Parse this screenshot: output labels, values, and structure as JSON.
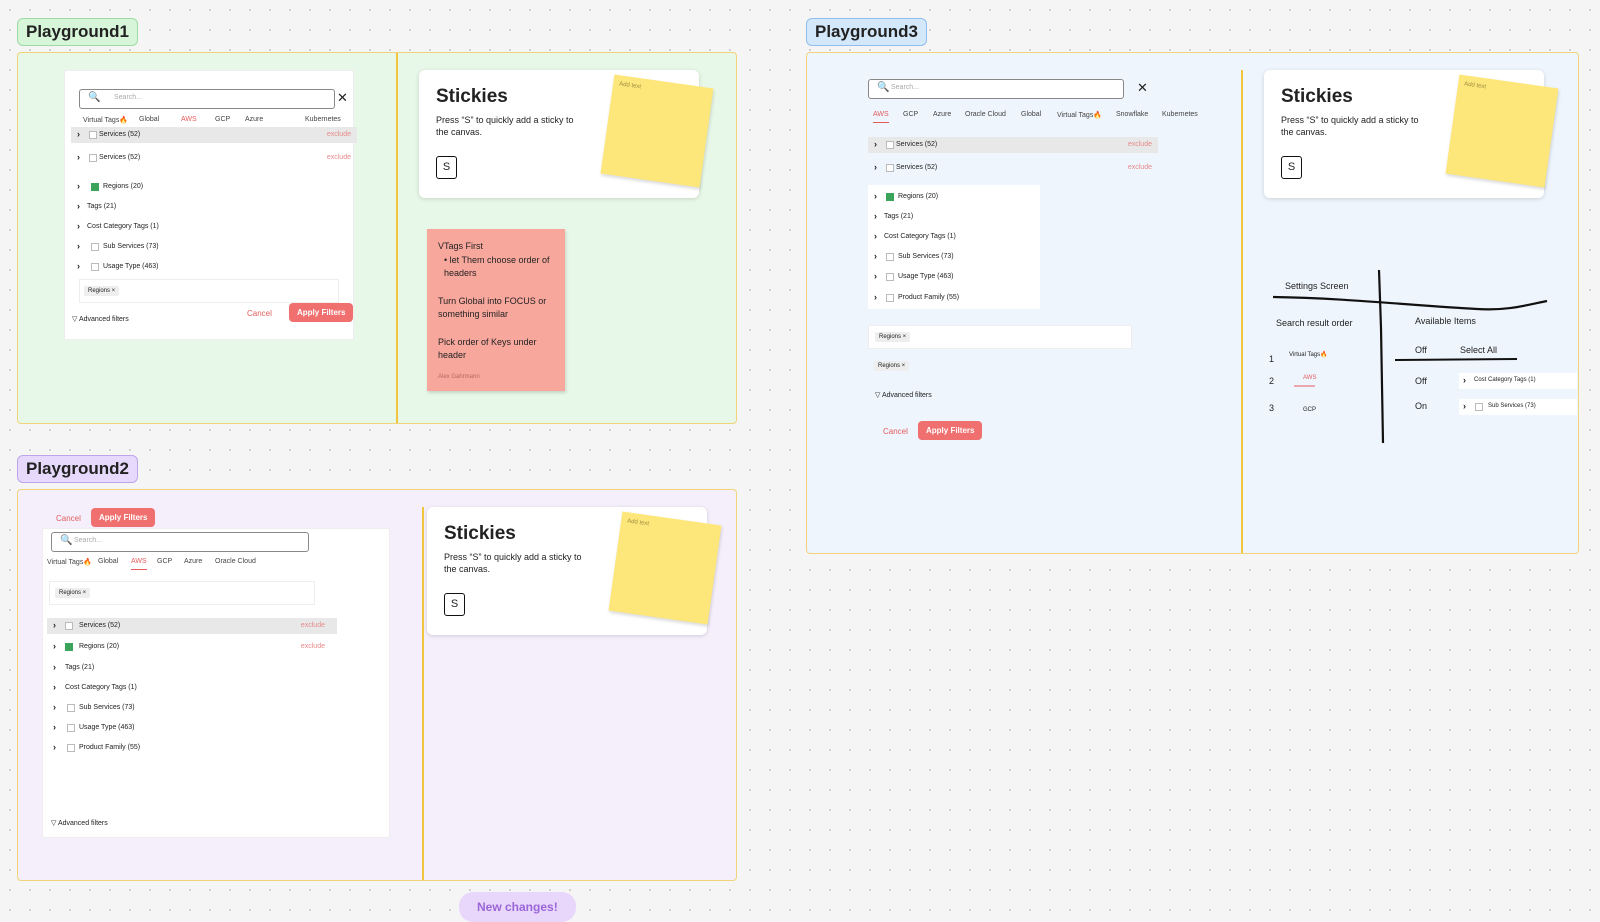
{
  "playground1": {
    "title": "Playground1"
  },
  "playground2": {
    "title": "Playground2"
  },
  "playground3": {
    "title": "Playground3"
  },
  "search_placeholder": "Search...",
  "close_glyph": "✕",
  "tabs_short": [
    "Virtual Tags🔥",
    "Global",
    "AWS",
    "GCP",
    "Azure",
    "Kubernetes"
  ],
  "tabs_p2": [
    "Virtual Tags🔥",
    "Global",
    "AWS",
    "GCP",
    "Azure",
    "Oracle Cloud"
  ],
  "tabs_p3": [
    "AWS",
    "GCP",
    "Azure",
    "Oracle Cloud",
    "Global",
    "Virtual Tags🔥",
    "Snowflake",
    "Kubernetes"
  ],
  "rows": {
    "services": "Services (52)",
    "regions": "Regions (20)",
    "tags": "Tags (21)",
    "cost_category": "Cost Category Tags (1)",
    "sub_services": "Sub Services (73)",
    "usage_type": "Usage Type (463)",
    "product_family": "Product Family (55)",
    "exclude": "exclude"
  },
  "chip_regions": "Regions ×",
  "advanced_filters": "Advanced filters",
  "cancel": "Cancel",
  "apply_filters": "Apply Filters",
  "stickies": {
    "title": "Stickies",
    "desc": "Press “S” to quickly add a sticky to the canvas.",
    "key": "S",
    "add_text": "Add text"
  },
  "pink_note": {
    "line1": "VTags First",
    "bullet": "let Them choose order of headers",
    "line2": "Turn Global into FOCUS or something similar",
    "line3": "Pick order of Keys under header",
    "author": "Alex Gahrmann"
  },
  "sketch": {
    "settings_screen": "Settings Screen",
    "search_result_order": "Search result order",
    "available_items": "Available Items",
    "off": "Off",
    "on": "On",
    "select_all": "Select All",
    "n1": "1",
    "n2": "2",
    "n3": "3",
    "virtual_tags": "Virtual Tags🔥",
    "aws": "AWS",
    "gcp": "GCP",
    "cost_category": "Cost Category Tags (1)",
    "sub_services": "Sub Services (73)"
  },
  "new_changes": "New changes!",
  "colors": {
    "p1_bg": "#e8f8e8",
    "p2_bg": "#f4effb",
    "p3_bg": "#eef5fc",
    "accent": "#f07070",
    "divider": "#f2c53d"
  }
}
